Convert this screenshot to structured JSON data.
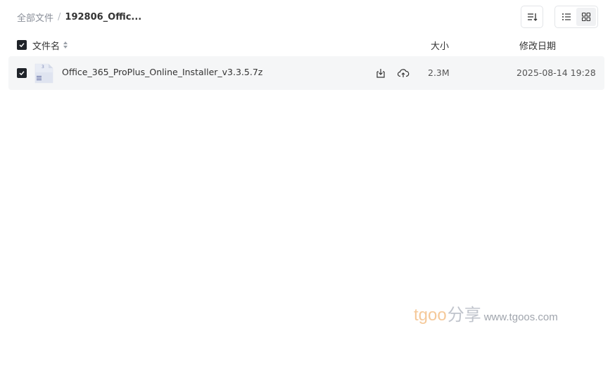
{
  "breadcrumb": {
    "root": "全部文件",
    "separator": "/",
    "current": "192806_Offic..."
  },
  "toolbar": {
    "sort_icon": "sort-lines-icon",
    "list_view_icon": "list-view-icon",
    "grid_view_icon": "grid-view-icon",
    "active_view": "list"
  },
  "table": {
    "columns": {
      "name": "文件名",
      "size": "大小",
      "modified": "修改日期"
    },
    "rows": [
      {
        "name": "Office_365_ProPlus_Online_Installer_v3.3.5.7z",
        "size": "2.3M",
        "modified": "2025-08-14 19:28",
        "checked": true,
        "icon": "archive-file-icon"
      }
    ]
  },
  "watermark": {
    "brand": "tgoo",
    "cn": "分享",
    "url": "www.tgoos.com"
  },
  "colors": {
    "checkbox": "#1f2329",
    "row_bg": "#f5f6f7",
    "brand_orange": "#f5c99a"
  }
}
